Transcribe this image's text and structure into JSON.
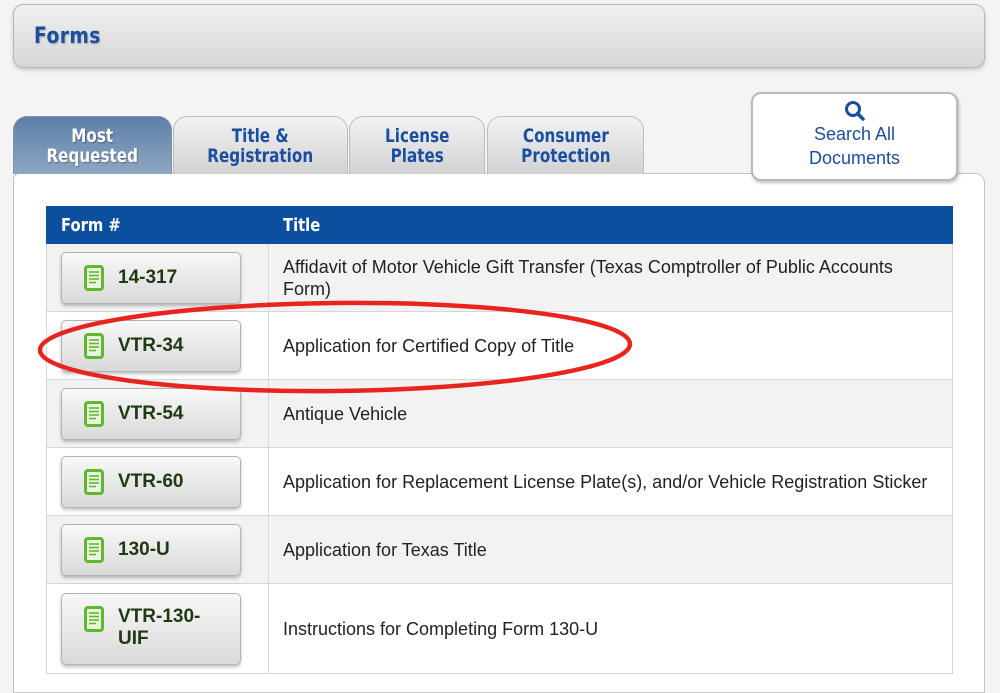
{
  "header": {
    "title": "Forms"
  },
  "tabs": [
    {
      "label": "Most\nRequested",
      "active": true
    },
    {
      "label": "Title &\nRegistration",
      "active": false
    },
    {
      "label": "License\nPlates",
      "active": false
    },
    {
      "label": "Consumer\nProtection",
      "active": false
    }
  ],
  "search_button": {
    "icon": "search-icon",
    "label": "Search All\nDocuments"
  },
  "table": {
    "columns": [
      "Form #",
      "Title"
    ],
    "rows": [
      {
        "form": "14-317",
        "title": "Affidavit of Motor Vehicle Gift Transfer (Texas Comptroller of Public Accounts Form)"
      },
      {
        "form": "VTR-34",
        "title": "Application for Certified Copy of Title",
        "highlighted": true
      },
      {
        "form": "VTR-54",
        "title": "Antique Vehicle"
      },
      {
        "form": "VTR-60",
        "title": "Application for Replacement License Plate(s), and/or Vehicle Registration Sticker"
      },
      {
        "form": "130-U",
        "title": "Application for Texas Title"
      },
      {
        "form": "VTR-130-\nUIF",
        "title": "Instructions for Completing Form 130-U"
      }
    ]
  },
  "colors": {
    "brand_blue": "#1a4fa0",
    "header_row": "#0b4f9e",
    "doc_icon_green": "#5fb830",
    "annotation_red": "#e8251c"
  }
}
